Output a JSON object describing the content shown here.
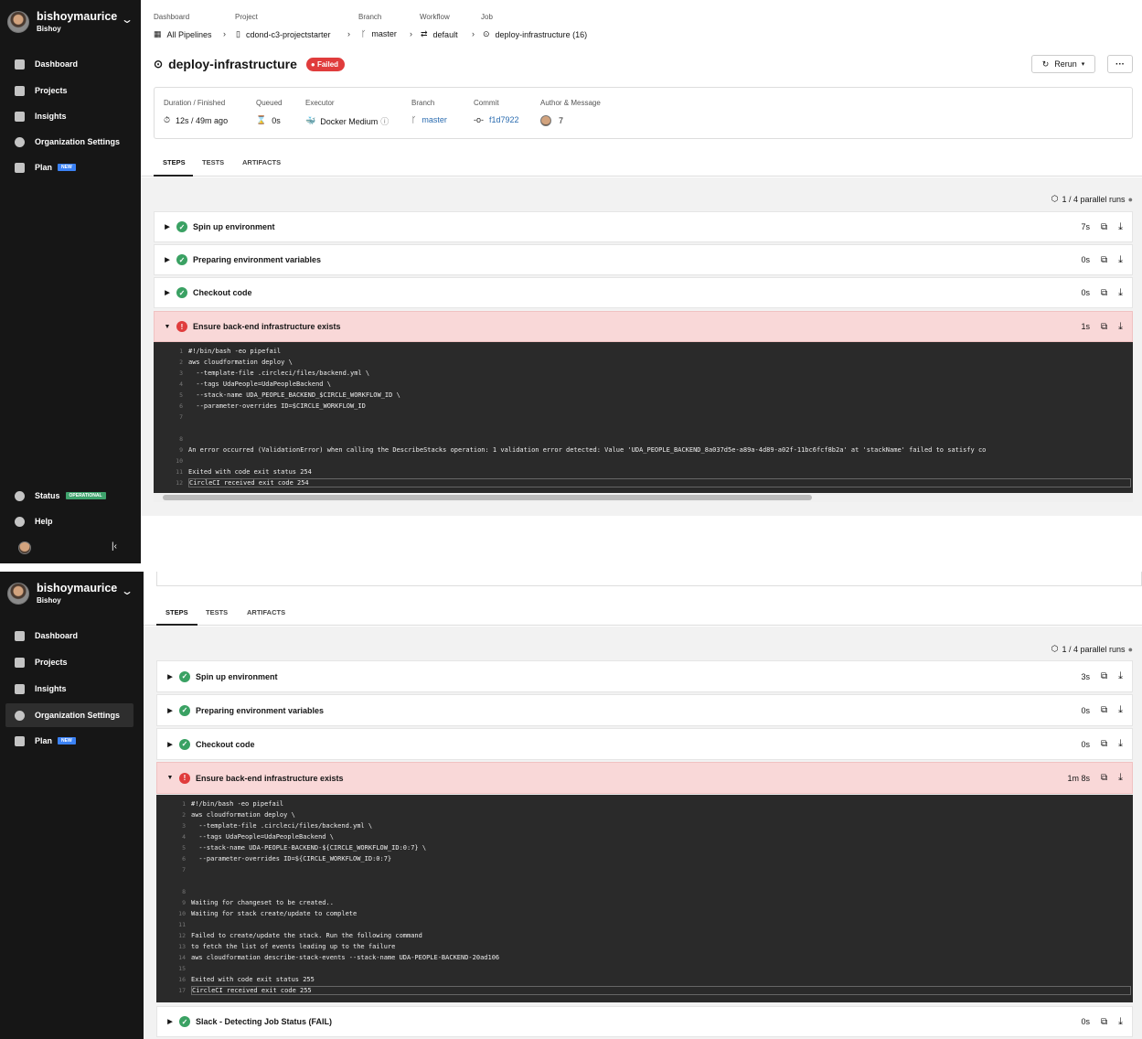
{
  "user": {
    "name": "bishoymaurice",
    "org": "Bishoy"
  },
  "nav": {
    "dashboard": "Dashboard",
    "projects": "Projects",
    "insights": "Insights",
    "org_settings": "Organization Settings",
    "plan": "Plan",
    "plan_badge": "NEW",
    "status": "Status",
    "status_badge": "OPERATIONAL",
    "help": "Help"
  },
  "breadcrumb": {
    "labels": [
      "Dashboard",
      "Project",
      "Branch",
      "Workflow",
      "Job"
    ],
    "values": [
      "All Pipelines",
      "cdond-c3-projectstarter",
      "master",
      "default",
      "deploy-infrastructure (16)"
    ]
  },
  "job": {
    "title": "deploy-infrastructure",
    "status": "Failed",
    "rerun": "Rerun",
    "more": "···"
  },
  "info": {
    "duration_label": "Duration / Finished",
    "duration": "12s / 49m ago",
    "queued_label": "Queued",
    "queued": "0s",
    "executor_label": "Executor",
    "executor": "Docker Medium",
    "branch_label": "Branch",
    "branch": "master",
    "commit_label": "Commit",
    "commit": "f1d7922",
    "author_label": "Author & Message",
    "message": "7"
  },
  "tabs": [
    "STEPS",
    "TESTS",
    "ARTIFACTS"
  ],
  "parallel": "1 / 4 parallel runs",
  "run1": {
    "steps": [
      {
        "name": "Spin up environment",
        "time": "7s"
      },
      {
        "name": "Preparing environment variables",
        "time": "0s"
      },
      {
        "name": "Checkout code",
        "time": "0s"
      },
      {
        "name": "Ensure back-end infrastructure exists",
        "time": "1s"
      }
    ],
    "log": [
      "#!/bin/bash -eo pipefail",
      "aws cloudformation deploy \\",
      "  --template-file .circleci/files/backend.yml \\",
      "  --tags UdaPeople=UdaPeopleBackend \\",
      "  --stack-name UDA_PEOPLE_BACKEND_$CIRCLE_WORKFLOW_ID \\",
      "  --parameter-overrides ID=$CIRCLE_WORKFLOW_ID",
      "",
      "",
      "An error occurred (ValidationError) when calling the DescribeStacks operation: 1 validation error detected: Value 'UDA_PEOPLE_BACKEND_8a037d5e-a89a-4d89-a02f-11bc6fcf8b2a' at 'stackName' failed to satisfy co",
      "",
      "Exited with code exit status 254",
      "CircleCI received exit code 254"
    ]
  },
  "run2": {
    "steps": [
      {
        "name": "Spin up environment",
        "time": "3s"
      },
      {
        "name": "Preparing environment variables",
        "time": "0s"
      },
      {
        "name": "Checkout code",
        "time": "0s"
      },
      {
        "name": "Ensure back-end infrastructure exists",
        "time": "1m 8s"
      },
      {
        "name": "Slack - Detecting Job Status (FAIL)",
        "time": "0s"
      }
    ],
    "log": [
      "#!/bin/bash -eo pipefail",
      "aws cloudformation deploy \\",
      "  --template-file .circleci/files/backend.yml \\",
      "  --tags UdaPeople=UdaPeopleBackend \\",
      "  --stack-name UDA-PEOPLE-BACKEND-${CIRCLE_WORKFLOW_ID:0:7} \\",
      "  --parameter-overrides ID=${CIRCLE_WORKFLOW_ID:0:7}",
      "",
      "",
      "Waiting for changeset to be created..",
      "Waiting for stack create/update to complete",
      "",
      "Failed to create/update the stack. Run the following command",
      "to fetch the list of events leading up to the failure",
      "aws cloudformation describe-stack-events --stack-name UDA-PEOPLE-BACKEND-20ad106",
      "",
      "Exited with code exit status 255",
      "CircleCI received exit code 255"
    ]
  }
}
